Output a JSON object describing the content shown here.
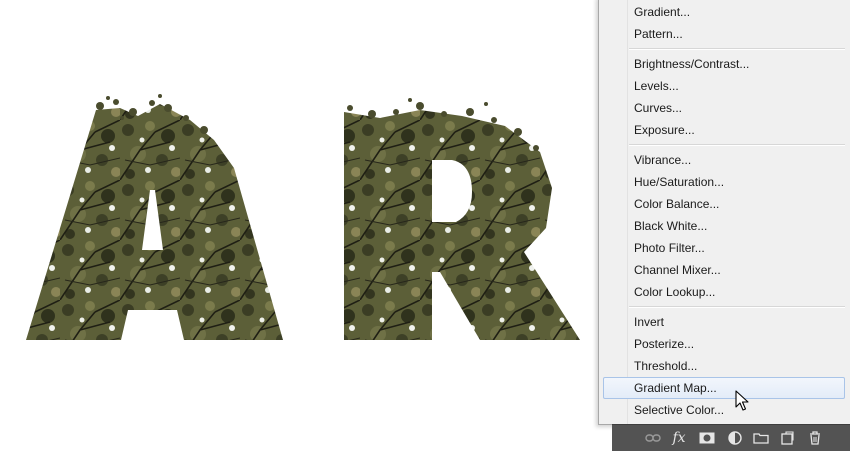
{
  "canvas": {
    "letters": [
      "A",
      "R"
    ],
    "texture": "tree-foliage"
  },
  "menu": {
    "groups": [
      [
        "Gradient...",
        "Pattern..."
      ],
      [
        "Brightness/Contrast...",
        "Levels...",
        "Curves...",
        "Exposure..."
      ],
      [
        "Vibrance...",
        "Hue/Saturation...",
        "Color Balance...",
        "Black  White...",
        "Photo Filter...",
        "Channel Mixer...",
        "Color Lookup..."
      ],
      [
        "Invert",
        "Posterize...",
        "Threshold...",
        "Gradient Map...",
        "Selective Color..."
      ]
    ],
    "highlighted": "Gradient Map..."
  },
  "toolbar": {
    "icons": [
      "link-layers-icon",
      "fx-icon",
      "add-mask-icon",
      "adjustment-layer-icon",
      "folder-icon",
      "new-layer-icon",
      "trash-icon"
    ],
    "fx_label": "fx"
  },
  "colors": {
    "menu_bg": "#f0f0f0",
    "highlight_border": "#a9c4e8",
    "toolbar_bg": "#535353",
    "foliage_dark": "#3b3d24",
    "foliage_light": "#6f7146"
  }
}
